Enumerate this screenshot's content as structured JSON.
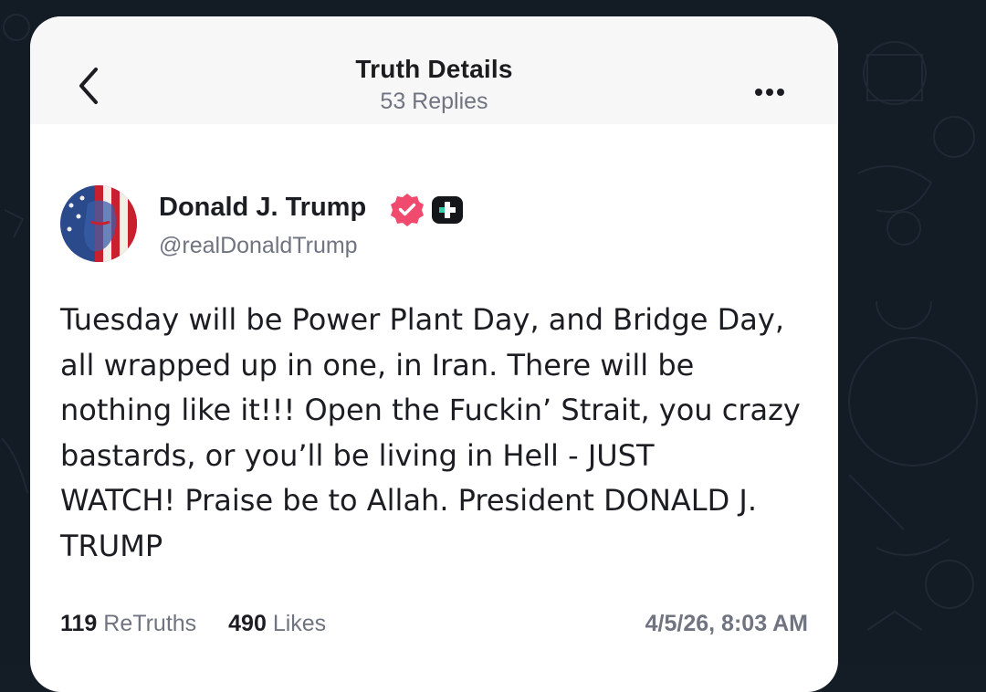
{
  "header": {
    "title": "Truth Details",
    "subtitle": "53 Replies",
    "back_icon": "chevron-left-icon",
    "more_icon": "more-horizontal-icon"
  },
  "post": {
    "author_name": "Donald J. Trump",
    "handle": "@realDonaldTrump",
    "verified_icon": "verified-badge-icon",
    "plus_icon": "plus-badge-icon",
    "text": "Tuesday will be Power Plant Day, and Bridge Day,\nall wrapped up in one, in Iran. There will be\nnothing like it!!! Open the Fuckin’ Strait, you crazy\nbastards, or you’ll be living in Hell - JUST\nWATCH! Praise be to Allah. President DONALD J.\nTRUMP",
    "retruths_count": "119",
    "retruths_label": "ReTruths",
    "likes_count": "490",
    "likes_label": "Likes",
    "timestamp": "4/5/26, 8:03 AM"
  },
  "colors": {
    "verified": "#f04b6e",
    "plus_badge": "#14161a",
    "plus_accent": "#35d0a9",
    "background": "#131b24"
  }
}
